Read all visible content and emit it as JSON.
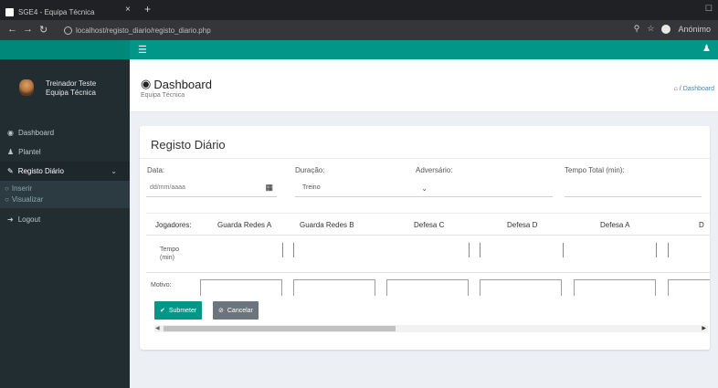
{
  "browser": {
    "tab_title": "SGE4 - Equipa Técnica",
    "tab_close": "×",
    "tab_new": "+",
    "window_control": "☐",
    "url": "localhost/registo_diario/registo_diario.php",
    "profile_label": "Anónimo"
  },
  "header": {
    "menu_icon": "hamburger-icon",
    "user_icon": "user-icon",
    "accent_color": "#009688"
  },
  "sidebar": {
    "user_name": "Treinador Teste\nEquipa Técnica",
    "items": [
      {
        "icon": "dashboard-icon",
        "label": "Dashboard"
      },
      {
        "icon": "users-icon",
        "label": "Plantel"
      },
      {
        "icon": "edit-icon",
        "label": "Registo Diário"
      },
      {
        "icon": "logout-icon",
        "label": "Logout"
      }
    ],
    "subitems": [
      {
        "label": "Inserir"
      },
      {
        "label": "Visualizar"
      }
    ]
  },
  "content_header": {
    "title": "Dashboard",
    "subtitle": "Equipa Técnica",
    "breadcrumb": "Dashboard"
  },
  "form": {
    "title": "Registo Diário",
    "fields": {
      "data_label": "Data:",
      "data_placeholder": "dd/mm/aaaa",
      "duracao_label": "Duração:",
      "duracao_value": "Treino",
      "adversario_label": "Adversário:",
      "tempo_total_label": "Tempo Total (min):"
    },
    "players_label": "Jogadores:",
    "players": [
      "Guarda Redes A",
      "Guarda Redes B",
      "Defesa C",
      "Defesa D",
      "Defesa A",
      "D"
    ],
    "tempo_label": "Tempo\n(min)",
    "motivo_label": "Motivo:",
    "submit_label": "Submeter",
    "cancel_label": "Cancelar"
  }
}
